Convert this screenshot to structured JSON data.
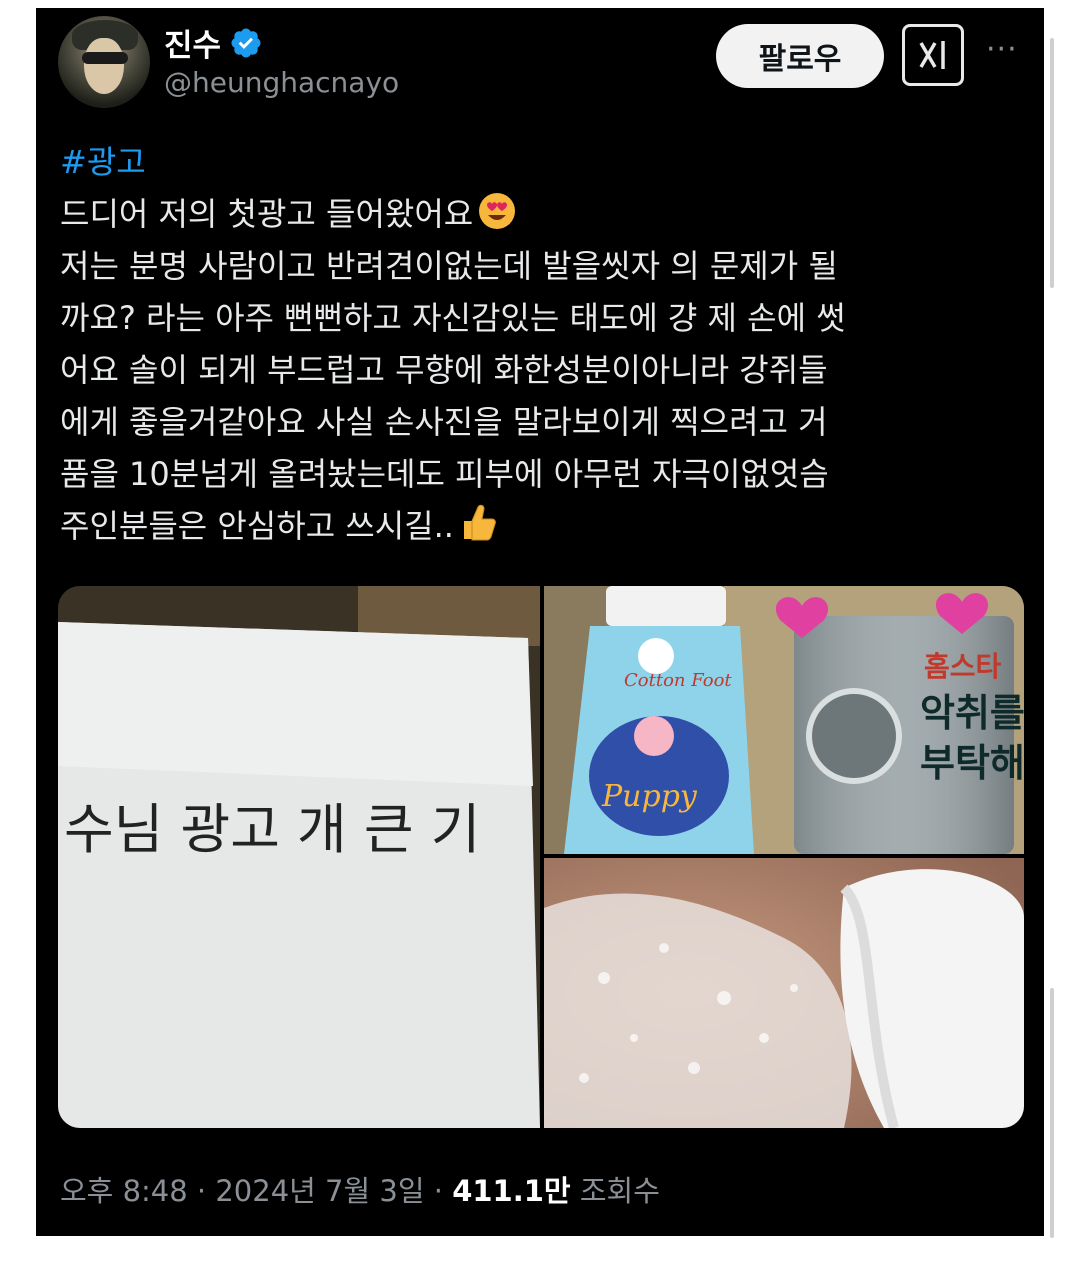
{
  "author": {
    "name": "진수",
    "handle": "@heunghacnayo",
    "verified": true
  },
  "actions": {
    "follow_label": "팔로우",
    "grok_icon": "grok-icon",
    "more_icon": "more-icon"
  },
  "post": {
    "hashtag": "#광고",
    "lines": [
      "드디어 저의 첫광고 들어왔어요",
      "저는 분명 사람이고 반려견이없는데 발을씻자 의 문제가 될",
      "까요? 라는 아주 뻔뻔하고 자신감있는 태도에 걍 제 손에 썻",
      "어요 솔이 되게 부드럽고 무향에 화한성분이아니라 강쥐들",
      "에게 좋을거같아요 사실 손사진을 말라보이게 찍으려고 거",
      "품을 10분넘게 올려놨는데도 피부에 아무런 자극이없엇슴",
      "주인분들은 안심하고 쓰시길.."
    ],
    "emoji_1": "heart-eyes-emoji",
    "emoji_2": "thumbs-up-emoji"
  },
  "media": {
    "paper_text": "수님 광고 개 큰 기",
    "product_left_text": "Cotton Foot",
    "product_left_sub": "Puppy",
    "product_right_text": "홈스타",
    "product_right_sub1": "악취를",
    "product_right_sub2": "부탁해"
  },
  "meta": {
    "time": "오후 8:48",
    "date": "2024년 7월 3일",
    "views_count": "411.1만",
    "views_label": "조회수"
  }
}
